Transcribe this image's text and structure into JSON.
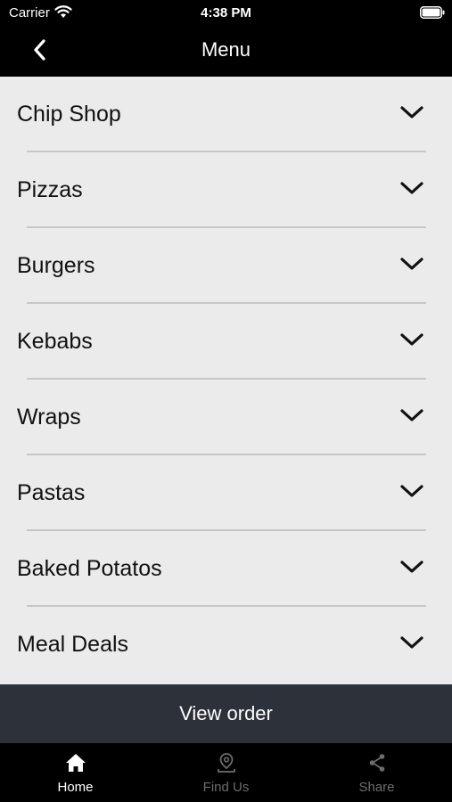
{
  "status_bar": {
    "carrier": "Carrier",
    "time": "4:38 PM"
  },
  "nav": {
    "title": "Menu",
    "back_icon": "chevron-left-icon"
  },
  "menu": {
    "items": [
      {
        "label": "Chip Shop"
      },
      {
        "label": "Pizzas"
      },
      {
        "label": "Burgers"
      },
      {
        "label": "Kebabs"
      },
      {
        "label": "Wraps"
      },
      {
        "label": "Pastas"
      },
      {
        "label": "Baked Potatos"
      },
      {
        "label": "Meal Deals"
      }
    ],
    "expand_icon": "chevron-down-icon"
  },
  "view_order": {
    "label": "View order"
  },
  "tabs": [
    {
      "label": "Home",
      "icon": "home-icon",
      "active": true
    },
    {
      "label": "Find Us",
      "icon": "location-pin-icon",
      "active": false
    },
    {
      "label": "Share",
      "icon": "share-icon",
      "active": false
    }
  ],
  "colors": {
    "bar_background": "#000000",
    "list_background": "#ebebeb",
    "view_order_background": "#2d313a",
    "active_tab": "#ffffff",
    "inactive_tab": "#6d6d6d"
  }
}
